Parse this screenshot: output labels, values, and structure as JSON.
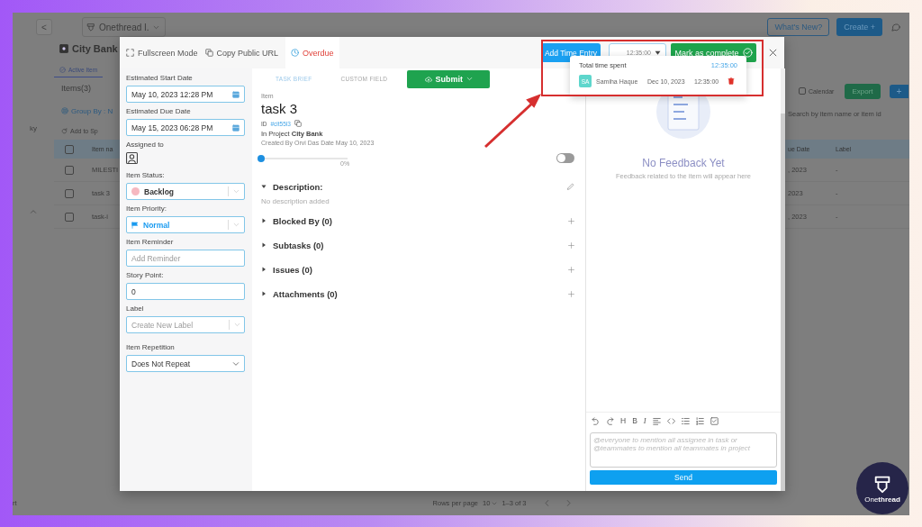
{
  "backdrop": {
    "back_button": "<",
    "workspace": "Onethread I.",
    "whats_new": "What's New?",
    "create": "Create +",
    "sidebar_top": "ky",
    "sidebar_bottom": "rt",
    "project": "City Bank",
    "view_tabs": [
      {
        "label": "Active Item",
        "selected": true
      }
    ],
    "items_count": "Items(3)",
    "group_by": "Group By : N",
    "add_to": "Add to Sp",
    "calendar": {
      "label": "Calendar",
      "checked": false
    },
    "export": "Export",
    "add": "+",
    "search": {
      "placeholder": "Search by item name or item id"
    },
    "table": {
      "header_checked": false,
      "columns": [
        "Item na",
        "ue Date",
        "Label"
      ],
      "rows": [
        {
          "checked": false,
          "name": "MILESTI",
          "due": ", 2023",
          "label": "-"
        },
        {
          "checked": false,
          "name": "task 3",
          "due": "2023",
          "label": "-"
        },
        {
          "checked": false,
          "name": "task-i",
          "due": ", 2023",
          "label": "-"
        }
      ]
    },
    "pagination": {
      "rows_per_page": "Rows per page",
      "page_size": "10",
      "range": "1–3 of 3"
    }
  },
  "modal": {
    "header": {
      "fullscreen": "Fullscreen Mode",
      "copy_url": "Copy Public URL",
      "overdue": "Overdue",
      "add_time": "Add Time Entry",
      "time_value": "12:35:00",
      "mark_complete": "Mark as complete"
    },
    "time_popover": {
      "title": "Total time spent",
      "total": "12:35:00",
      "entries": [
        {
          "initials": "SA",
          "name": "Samiha Haque",
          "date": "Dec 10, 2023",
          "time": "12:35:00"
        }
      ]
    },
    "fields": [
      {
        "kind": "date",
        "label": "Estimated Start Date",
        "value": "May 10, 2023 12:28 PM"
      },
      {
        "kind": "date",
        "label": "Estimated Due Date",
        "value": "May 15, 2023 06:28 PM"
      },
      {
        "kind": "assignee",
        "label": "Assigned to"
      },
      {
        "kind": "status",
        "label": "Item Status:",
        "value": "Backlog",
        "color": "#f6b8c0"
      },
      {
        "kind": "priority",
        "label": "Item Priority:",
        "value": "Normal",
        "color": "#1a9bf0"
      },
      {
        "kind": "input",
        "label": "Item Reminder",
        "placeholder": "Add Reminder"
      },
      {
        "kind": "input",
        "label": "Story Point:",
        "value": "0"
      },
      {
        "kind": "select",
        "label": "Label",
        "placeholder": "Create New Label"
      },
      {
        "kind": "native_select",
        "label": "Item Repetition",
        "value": "Does Not Repeat"
      }
    ],
    "tabs": [
      {
        "label": "TASK BRIEF",
        "selected": true
      },
      {
        "label": "CUSTOM FIELD",
        "selected": false
      }
    ],
    "submit": "Submit",
    "item": {
      "caption": "Item",
      "title": "task 3",
      "id_label": "ID",
      "id": "#cit55l3",
      "project": "In Project **City Bank**",
      "created": "Created By  Orvi Das  Date May 10, 2023",
      "progress": {
        "level": 0,
        "reading": "0%"
      },
      "toggle_on": false
    },
    "sections": [
      {
        "title": "Description:",
        "expanded": true,
        "kind": "editable",
        "body": "No description added"
      },
      {
        "title": "Blocked By (0)",
        "expanded": false,
        "kind": "addable"
      },
      {
        "title": "Subtasks (0)",
        "expanded": false,
        "kind": "addable"
      },
      {
        "title": "Issues (0)",
        "expanded": false,
        "kind": "addable"
      },
      {
        "title": "Attachments (0)",
        "expanded": false,
        "kind": "addable"
      }
    ],
    "feedback": {
      "title": "No Feedback Yet",
      "subtitle": "Feedback related to the item will appear here",
      "toolbar": [
        {
          "kind": "undo"
        },
        {
          "kind": "redo"
        },
        {
          "kind": "glyph",
          "label": "H"
        },
        {
          "kind": "glyph",
          "label": "B"
        },
        {
          "kind": "italic_glyph",
          "label": "I"
        },
        {
          "kind": "align"
        },
        {
          "kind": "code"
        },
        {
          "kind": "bullets"
        },
        {
          "kind": "numbers"
        },
        {
          "kind": "checklist"
        }
      ],
      "composer": {
        "placeholder": "@everyone to mention all assignee in task or @teammates to mention all teammates in project"
      },
      "send": "Send"
    }
  },
  "brand_badge": "One**thread**"
}
